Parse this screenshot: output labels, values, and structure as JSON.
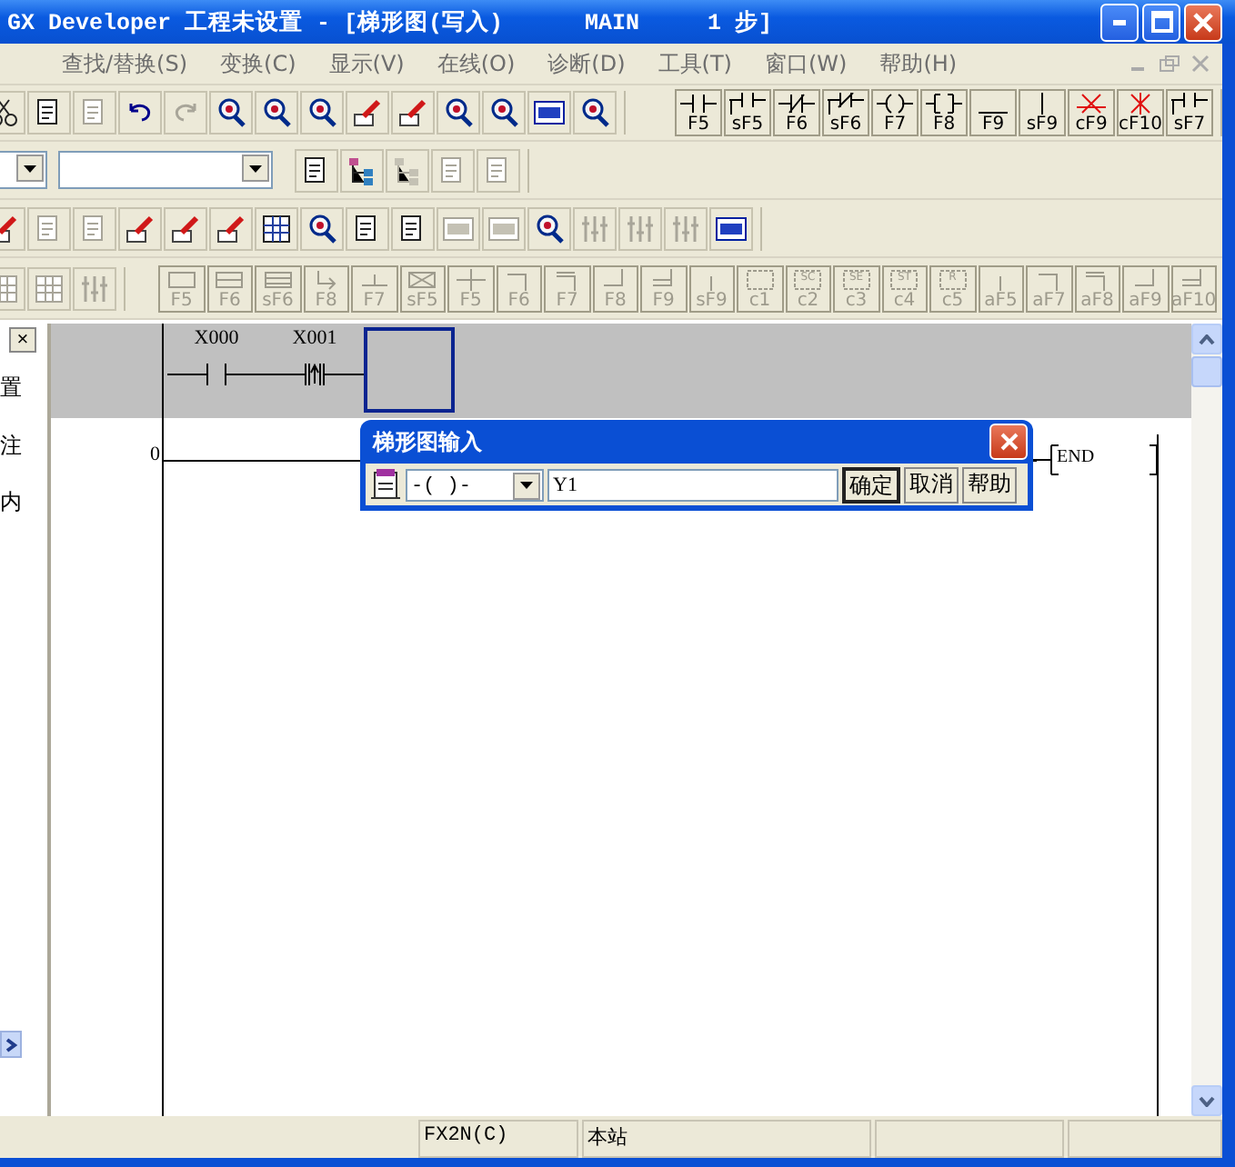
{
  "window": {
    "title": "GX Developer 工程未设置 - [梯形图(写入)      MAIN     1 步]"
  },
  "menu": [
    "查找/替换(S)",
    "变换(C)",
    "显示(V)",
    "在线(O)",
    "诊断(D)",
    "工具(T)",
    "窗口(W)",
    "帮助(H)"
  ],
  "toolbar_1": {
    "icons": [
      {
        "disabled": false
      },
      {
        "disabled": false
      },
      {
        "disabled": true
      },
      {
        "disabled": false
      },
      {
        "disabled": true
      },
      {
        "disabled": false
      },
      {
        "disabled": false
      },
      {
        "disabled": false
      },
      {
        "disabled": false
      },
      {
        "disabled": false
      },
      {
        "disabled": false
      },
      {
        "disabled": false
      },
      {
        "disabled": false
      },
      {
        "disabled": false
      }
    ],
    "keys": [
      {
        "kind": "contact",
        "label": "F5",
        "disabled": false
      },
      {
        "kind": "contact-branch",
        "label": "sF5",
        "disabled": false
      },
      {
        "kind": "nc-contact",
        "label": "F6",
        "disabled": false
      },
      {
        "kind": "nc-branch",
        "label": "sF6",
        "disabled": false
      },
      {
        "kind": "coil",
        "label": "F7",
        "disabled": false
      },
      {
        "kind": "instruction",
        "label": "F8",
        "disabled": false
      },
      {
        "kind": "hline",
        "label": "F9",
        "disabled": false
      },
      {
        "kind": "vline",
        "label": "sF9",
        "disabled": false
      },
      {
        "kind": "hdelete",
        "label": "cF9",
        "disabled": false
      },
      {
        "kind": "vdelete",
        "label": "cF10",
        "disabled": false
      },
      {
        "kind": "contact-branch",
        "label": "sF7",
        "disabled": false
      }
    ]
  },
  "toolbar_2": {
    "icons": [
      {
        "disabled": false
      },
      {
        "disabled": false
      },
      {
        "disabled": true
      },
      {
        "disabled": true
      },
      {
        "disabled": true
      }
    ]
  },
  "toolbar_3": {
    "icons": [
      {
        "disabled": false
      },
      {
        "disabled": true
      },
      {
        "disabled": true
      },
      {
        "disabled": false
      },
      {
        "disabled": false
      },
      {
        "disabled": false
      },
      {
        "disabled": false
      },
      {
        "disabled": false
      },
      {
        "disabled": false
      },
      {
        "disabled": false
      },
      {
        "disabled": true
      },
      {
        "disabled": true
      },
      {
        "disabled": false
      },
      {
        "disabled": true
      },
      {
        "disabled": true
      },
      {
        "disabled": true
      },
      {
        "disabled": false
      }
    ]
  },
  "toolbar_4": {
    "icons": [
      {
        "disabled": true
      },
      {
        "disabled": true
      },
      {
        "disabled": true
      }
    ],
    "keys": [
      {
        "kind": "box",
        "label": "F5",
        "disabled": true
      },
      {
        "kind": "box2",
        "label": "F6",
        "disabled": true
      },
      {
        "kind": "box3",
        "label": "sF6",
        "disabled": true
      },
      {
        "kind": "arrow",
        "label": "F8",
        "disabled": true
      },
      {
        "kind": "tee",
        "label": "F7",
        "disabled": true
      },
      {
        "kind": "xbox",
        "label": "sF5",
        "disabled": true
      },
      {
        "kind": "cross",
        "label": "F5",
        "disabled": true
      },
      {
        "kind": "corner",
        "label": "F6",
        "disabled": true
      },
      {
        "kind": "corner2",
        "label": "F7",
        "disabled": true
      },
      {
        "kind": "corner-up",
        "label": "F8",
        "disabled": true
      },
      {
        "kind": "eq-up",
        "label": "F9",
        "disabled": true
      },
      {
        "kind": "tick",
        "label": "sF9",
        "disabled": true
      },
      {
        "kind": "dashbox",
        "label": "c1",
        "disabled": true
      },
      {
        "kind": "dashbox",
        "label": "c2",
        "mark": "SC",
        "disabled": true
      },
      {
        "kind": "dashbox",
        "label": "c3",
        "mark": "SE",
        "disabled": true
      },
      {
        "kind": "dashbox",
        "label": "c4",
        "mark": "ST",
        "disabled": true
      },
      {
        "kind": "dashbox",
        "label": "c5",
        "mark": "R",
        "disabled": true
      },
      {
        "kind": "tick",
        "label": "aF5",
        "disabled": true
      },
      {
        "kind": "corner",
        "label": "aF7",
        "disabled": true
      },
      {
        "kind": "corner2",
        "label": "aF8",
        "disabled": true
      },
      {
        "kind": "corner-up",
        "label": "aF9",
        "disabled": true
      },
      {
        "kind": "eq-up",
        "label": "aF10",
        "disabled": true
      }
    ]
  },
  "side_panel": {
    "close": "×",
    "items": [
      "置",
      "注",
      "内"
    ]
  },
  "ladder": {
    "rungs": [
      {
        "editing": true,
        "cells": [
          {
            "kind": "contact",
            "device": "X000"
          },
          {
            "kind": "rising-contact",
            "device": "X001"
          },
          {
            "kind": "cursor"
          }
        ]
      },
      {
        "step": "0",
        "editing": false,
        "end": "END"
      }
    ]
  },
  "dialog": {
    "title": "梯形图输入",
    "symbol": "-( )-",
    "value": "Y1",
    "buttons": [
      {
        "label": "确定",
        "default": true
      },
      {
        "label": "取消",
        "default": false
      },
      {
        "label": "帮助",
        "default": false
      }
    ]
  },
  "status_bar": {
    "plc": "FX2N(C)",
    "station": "本站"
  }
}
